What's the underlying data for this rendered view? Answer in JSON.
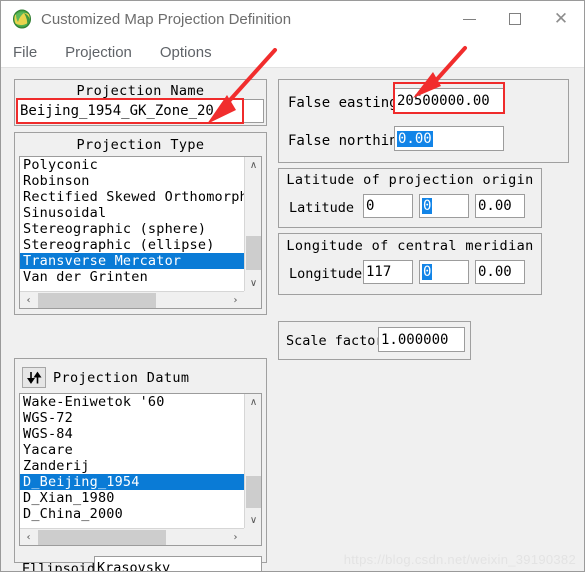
{
  "window": {
    "title": "Customized Map Projection Definition",
    "icon": "globe-icon",
    "minimize_label": "—",
    "maximize_label": "□",
    "close_label": "✕"
  },
  "menu": {
    "items": [
      {
        "label": "File"
      },
      {
        "label": "Projection"
      },
      {
        "label": "Options"
      }
    ]
  },
  "projection_name": {
    "group_title": "Projection Name",
    "value": "Beijing_1954_GK_Zone_20"
  },
  "projection_type": {
    "group_title": "Projection Type",
    "items": [
      {
        "label": "Polyconic",
        "selected": false
      },
      {
        "label": "Robinson",
        "selected": false
      },
      {
        "label": "Rectified Skewed Orthomorphi",
        "selected": false
      },
      {
        "label": "Sinusoidal",
        "selected": false
      },
      {
        "label": "Stereographic (sphere)",
        "selected": false
      },
      {
        "label": "Stereographic (ellipse)",
        "selected": false
      },
      {
        "label": "Transverse Mercator",
        "selected": true
      },
      {
        "label": "Van der Grinten",
        "selected": false
      }
    ],
    "scroll_up": "∧",
    "scroll_down": "∨",
    "scroll_left": "‹",
    "scroll_right": "›"
  },
  "projection_datum": {
    "group_title": "Projection Datum",
    "sort_icon": "sort-down-up-icon",
    "items": [
      {
        "label": "Wake-Eniwetok '60",
        "selected": false
      },
      {
        "label": "WGS-72",
        "selected": false
      },
      {
        "label": "WGS-84",
        "selected": false
      },
      {
        "label": "Yacare",
        "selected": false
      },
      {
        "label": "Zanderij",
        "selected": false
      },
      {
        "label": "D_Beijing_1954",
        "selected": true
      },
      {
        "label": "D_Xian_1980",
        "selected": false
      },
      {
        "label": "D_China_2000",
        "selected": false
      }
    ],
    "scroll_up": "∧",
    "scroll_down": "∨",
    "scroll_left": "‹",
    "scroll_right": "›",
    "ellipsoid_label": "Ellipsoid",
    "ellipsoid_value": "Krasovsky"
  },
  "false_offsets": {
    "easting_label": "False easting",
    "easting_value": "20500000.00",
    "northing_label": "False northing",
    "northing_value": "0.00",
    "northing_selected": true
  },
  "latitude_origin": {
    "group_title": "Latitude of projection origin",
    "field_label": "Latitude",
    "degrees": "0",
    "minutes": "0",
    "minutes_selected": true,
    "seconds": "0.00"
  },
  "longitude_meridian": {
    "group_title": "Longitude of central meridian",
    "field_label": "Longitude",
    "degrees": "117",
    "minutes": "0",
    "minutes_selected": true,
    "seconds": "0.00"
  },
  "scale_factor": {
    "label": "Scale factor",
    "value": "1.000000"
  },
  "annotations": {
    "highlight_color": "#ef2b2b",
    "arrow_color": "#f12d2d"
  },
  "watermark": {
    "text": "https://blog.csdn.net/weixin_39190382"
  }
}
